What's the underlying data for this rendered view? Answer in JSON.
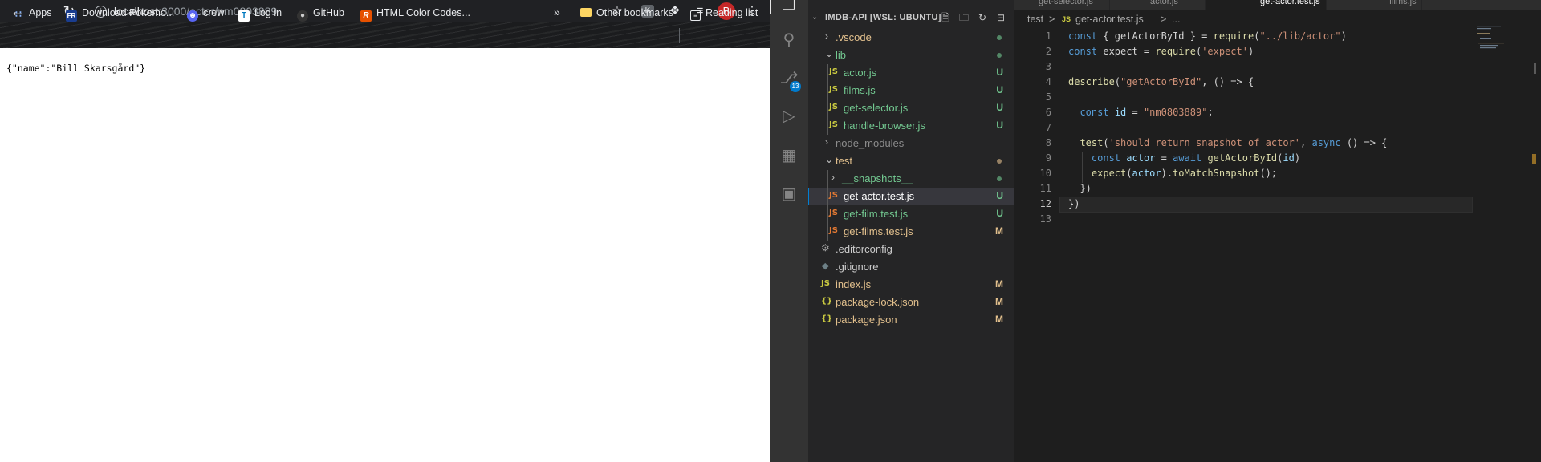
{
  "browser": {
    "url_host": "localhost",
    "url_path": ":3000/actor/nm0803889",
    "avatar_initial": "B",
    "bookmarks": [
      {
        "label": "Apps",
        "icon": "apps-grid-icon"
      },
      {
        "label": "Download Pokemo...",
        "icon": "fr-site-icon"
      },
      {
        "label": "crew",
        "icon": "discord-icon"
      },
      {
        "label": "Log in",
        "icon": "trello-icon"
      },
      {
        "label": "GitHub",
        "icon": "github-icon"
      },
      {
        "label": "HTML Color Codes...",
        "icon": "html-color-icon"
      }
    ],
    "overflow_label": "»",
    "other_bookmarks": "Other bookmarks",
    "reading_list": "Reading list",
    "page_content": "{\"name\":\"Bill Skarsgård\"}"
  },
  "vscode": {
    "activity_badge": "13",
    "explorer_title": "IMDB-API [WSL: UBUNTU]",
    "tree": [
      {
        "label": ".vscode",
        "kind": "folder",
        "collapsed": true,
        "status": "dot"
      },
      {
        "label": "lib",
        "kind": "folder",
        "collapsed": false,
        "status": "dot"
      },
      {
        "label": "actor.js",
        "kind": "js",
        "status": "U"
      },
      {
        "label": "films.js",
        "kind": "js",
        "status": "U"
      },
      {
        "label": "get-selector.js",
        "kind": "js",
        "status": "U"
      },
      {
        "label": "handle-browser.js",
        "kind": "js",
        "status": "U"
      },
      {
        "label": "node_modules",
        "kind": "folder",
        "collapsed": true,
        "status": ""
      },
      {
        "label": "test",
        "kind": "folder",
        "collapsed": false,
        "status": "dot"
      },
      {
        "label": "__snapshots__",
        "kind": "folder",
        "collapsed": true,
        "status": "dot"
      },
      {
        "label": "get-actor.test.js",
        "kind": "js",
        "status": "U"
      },
      {
        "label": "get-film.test.js",
        "kind": "js",
        "status": "U"
      },
      {
        "label": "get-films.test.js",
        "kind": "js",
        "status": "M"
      },
      {
        "label": ".editorconfig",
        "kind": "gear",
        "status": ""
      },
      {
        "label": ".gitignore",
        "kind": "text",
        "status": ""
      },
      {
        "label": "index.js",
        "kind": "js",
        "status": "M"
      },
      {
        "label": "package-lock.json",
        "kind": "json",
        "status": "M"
      },
      {
        "label": "package.json",
        "kind": "json",
        "status": "M"
      }
    ],
    "tabs": [
      "get-selector.js",
      "actor.js",
      "get-actor.test.js",
      "films.js"
    ],
    "breadcrumbs": [
      "test",
      ">",
      "JS",
      "get-actor.test.js",
      ">",
      "..."
    ],
    "line_numbers": [
      "1",
      "2",
      "3",
      "4",
      "5",
      "6",
      "7",
      "8",
      "9",
      "10",
      "11",
      "12",
      "13"
    ],
    "code_lines": [
      "const { getActorById } = require(\"../lib/actor\")",
      "const expect = require('expect')",
      "",
      "describe(\"getActorById\", () => {",
      "",
      "  const id = \"nm0803889\";",
      "",
      "  test('should return snapshot of actor', async () => {",
      "    const actor = await getActorById(id)",
      "    expect(actor).toMatchSnapshot();",
      "  })",
      "})",
      ""
    ]
  }
}
